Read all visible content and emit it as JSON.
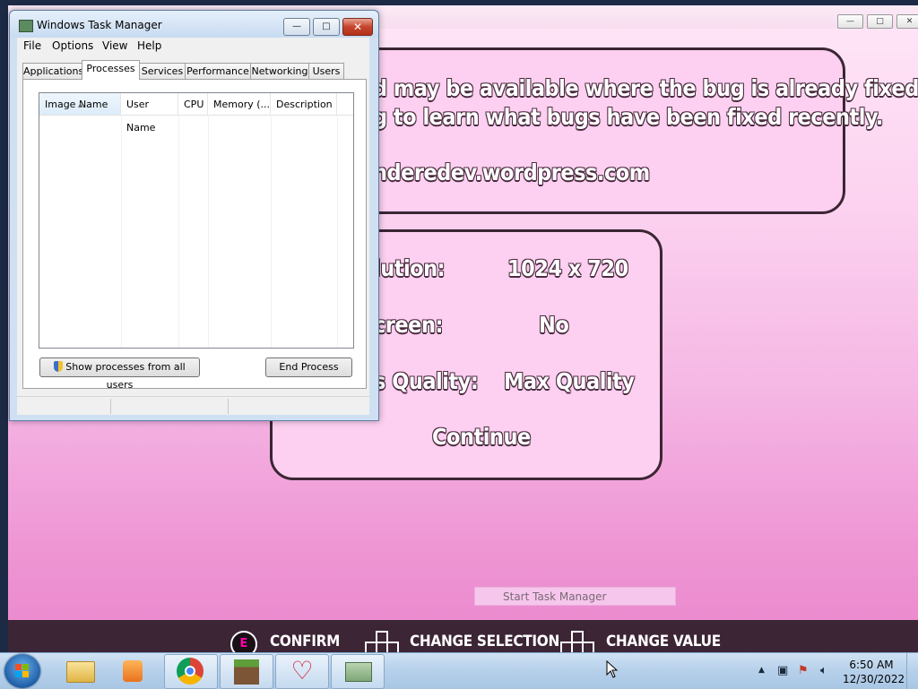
{
  "game": {
    "panel1_line1": "d may be available where the bug is already fixed. Please",
    "panel1_line2": "g to learn what bugs have been fixed recently.",
    "panel1_line3": "nderedev.wordpress.com",
    "settings": [
      {
        "label": "lution:",
        "value": "1024 x 720"
      },
      {
        "label": "creen:",
        "value": "No"
      },
      {
        "label": "s Quality:",
        "value": "Max Quality"
      }
    ],
    "continue": "Continue",
    "hints": {
      "confirm_key": "E",
      "confirm": "CONFIRM",
      "change_selection": "CHANGE SELECTION",
      "change_value": "CHANGE VALUE"
    },
    "tooltip": "Start Task Manager",
    "colors": {
      "panel_border": "#3b2634",
      "panel_fill": "#fdcff0",
      "bar": "#3c2535"
    }
  },
  "task_manager": {
    "title": "Windows Task Manager",
    "menu": [
      "File",
      "Options",
      "View",
      "Help"
    ],
    "tabs": [
      "Applications",
      "Processes",
      "Services",
      "Performance",
      "Networking",
      "Users"
    ],
    "active_tab": "Processes",
    "columns": [
      "Image Name",
      "User Name",
      "CPU",
      "Memory (...",
      "Description"
    ],
    "show_all_button": "Show processes from all users",
    "end_process_button": "End Process",
    "window_buttons": {
      "minimize": "—",
      "maximize": "□",
      "close": "✕"
    }
  },
  "taskbar": {
    "apps": [
      "windows-explorer-icon",
      "media-player-icon",
      "chrome-icon",
      "minecraft-icon",
      "yandere-game-icon",
      "task-manager-icon"
    ],
    "clock_time": "6:50 AM",
    "clock_date": "12/30/2022"
  }
}
